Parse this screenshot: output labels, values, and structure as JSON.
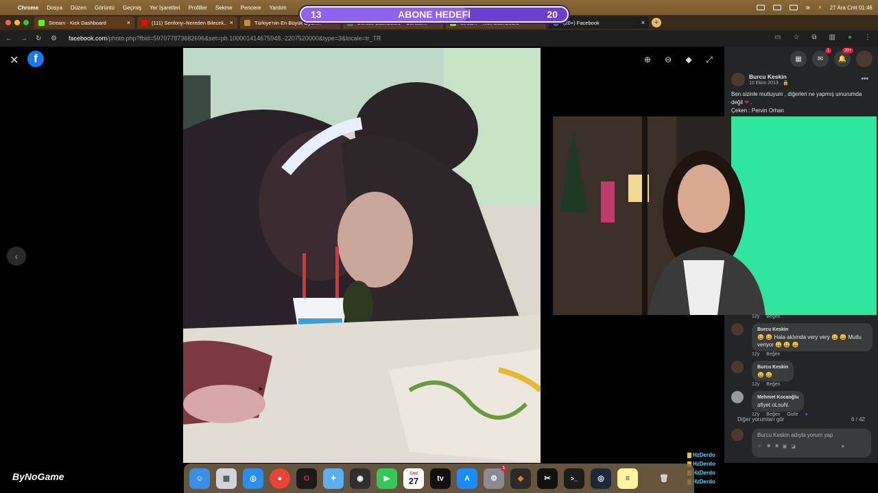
{
  "menubar": {
    "app": "Chrome",
    "items": [
      "Dosya",
      "Düzen",
      "Görüntü",
      "Geçmiş",
      "Yer İşaretleri",
      "Profiller",
      "Sekme",
      "Pencere",
      "Yardım"
    ],
    "clock": "27 Ara Cmt  01:46"
  },
  "goal": {
    "left": "13",
    "label": "ABONE HEDEFİ",
    "right": "20",
    "progress": 0.63
  },
  "tabs": [
    {
      "title": "Stream - Kick Dashboard",
      "color": "#53fc18"
    },
    {
      "title": "(111) Senfony–Nereden Bilecek...",
      "color": "#ff0000"
    },
    {
      "title": "Türkiye'nin En Büyük Oyun...",
      "color": "#8a6a3a"
    },
    {
      "title": "Donate Dashboard – Donate...",
      "color": "#3c8d3c"
    },
    {
      "title": "Stream – Kick Dashboard",
      "color": "#53fc18"
    },
    {
      "title": "(20+) Facebook",
      "color": "#1877f2"
    }
  ],
  "address": {
    "domain": "facebook.com",
    "path": "/photo.php?fbid=597077873682696&set=pb.100001414675948.-2207520000&type=3&locale=tr_TR"
  },
  "fb": {
    "messenger_badge": "1",
    "notif_badge": "20+",
    "poster": "Burcu Keskin",
    "date": "10 Ekim 2013 · 🔒",
    "caption_1": "Ben sizinle mutluyum , diğerleri ne yapmış umurumda değil",
    "caption_2": "Çeken : Pervin Orhan",
    "meta_age": "12y",
    "meta_like": "Beğen",
    "meta_hide": "Gizle",
    "comments": [
      {
        "name": "Burcu Keskin",
        "text": "😀 😀 Hala aklımda very very 😀 😀 Mutlu veriyor 😀 😀 😀"
      },
      {
        "name": "Burcu Keskin",
        "text": "😀 😀"
      },
      {
        "name": "Mehmet Kocaoğlu",
        "text": "afiyet oLsuN."
      }
    ],
    "more_comments": "Diğer yorumları gör",
    "comment_count": "6 / 42",
    "composer_placeholder": "Burcu Keskin adıyla yorum yap"
  },
  "overlay": {
    "viewer": "HzDerdo"
  },
  "brand": "ByNoGame",
  "dock": {
    "calendar_month": "Cmt",
    "calendar_day": "27",
    "settings_badge": "1",
    "tv_label": "tv"
  },
  "icons": {
    "close": "close-icon",
    "zoom_in": "zoom-in-icon",
    "zoom_out": "zoom-out-icon",
    "tag": "tag-icon",
    "fullscreen": "fullscreen-icon"
  },
  "colors": {
    "fb_blue": "#1877f2",
    "fb_panel": "#242526",
    "goal_purple": "#6c3fd1"
  }
}
